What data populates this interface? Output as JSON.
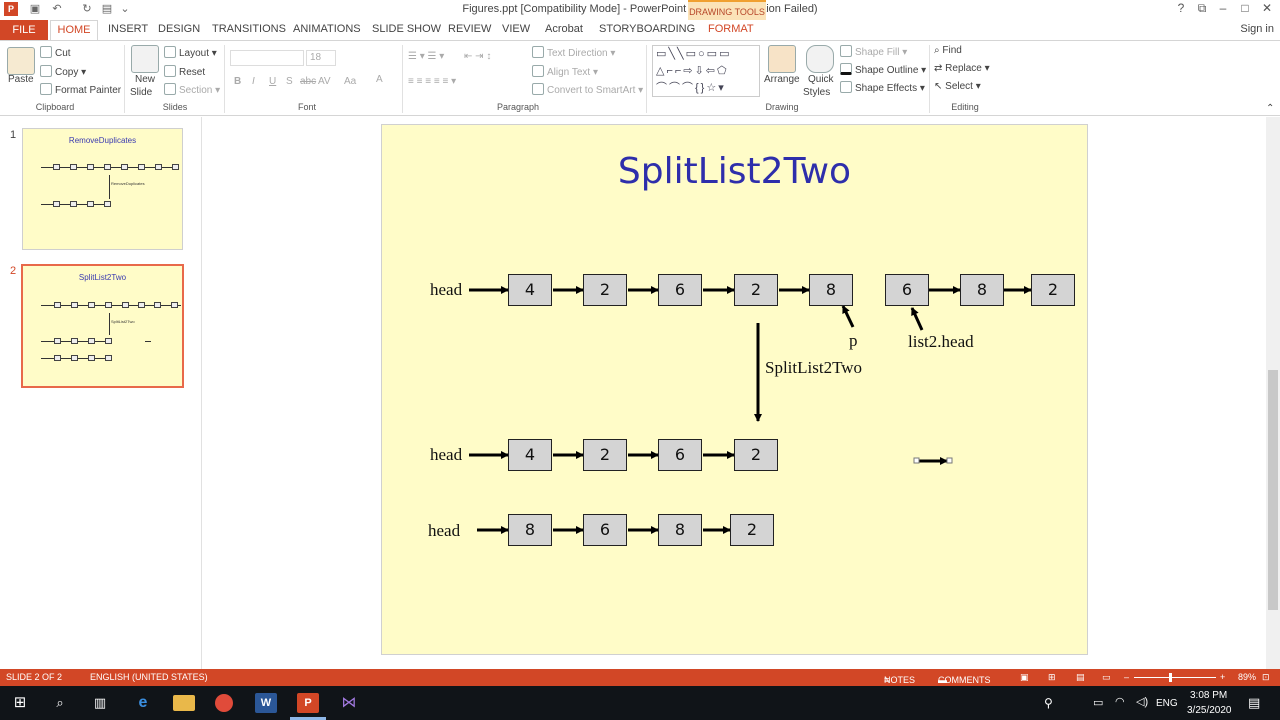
{
  "app": {
    "window_title": "Figures.ppt [Compatibility Mode] - PowerPoint (Product Activation Failed)",
    "drawing_tools_label": "DRAWING TOOLS",
    "sign_in": "Sign in",
    "window_controls": [
      "?",
      "⧉",
      "–",
      "□",
      "✕"
    ]
  },
  "tabs": [
    "FILE",
    "HOME",
    "INSERT",
    "DESIGN",
    "TRANSITIONS",
    "ANIMATIONS",
    "SLIDE SHOW",
    "REVIEW",
    "VIEW",
    "Acrobat",
    "STORYBOARDING",
    "FORMAT"
  ],
  "ribbon": {
    "clipboard": {
      "paste": "Paste",
      "cut": "Cut",
      "copy": "Copy",
      "format_painter": "Format Painter",
      "label": "Clipboard"
    },
    "slides": {
      "new_slide": "New",
      "new_slide2": "Slide",
      "layout": "Layout",
      "reset": "Reset",
      "section": "Section",
      "label": "Slides"
    },
    "font": {
      "size": "18",
      "label": "Font",
      "buttons": [
        "B",
        "I",
        "U",
        "S",
        "abc",
        "AV",
        "Aa",
        "A"
      ]
    },
    "paragraph": {
      "text_direction": "Text Direction",
      "align_text": "Align Text",
      "convert_smartart": "Convert to SmartArt",
      "label": "Paragraph"
    },
    "drawing": {
      "arrange": "Arrange",
      "quick_styles": "Quick",
      "quick_styles2": "Styles",
      "shape_fill": "Shape Fill",
      "shape_outline": "Shape Outline",
      "shape_effects": "Shape Effects",
      "label": "Drawing",
      "shapes_row1": "▭╲╲▭○▭▭",
      "shapes_row2": "△⌐⌐⇨⇩⇦⬠",
      "shapes_row3": "⌒⌒⌒{}☆▾"
    },
    "editing": {
      "find": "Find",
      "replace": "Replace",
      "select": "Select",
      "label": "Editing"
    }
  },
  "thumbnails": [
    {
      "num": "1",
      "title": "RemoveDuplicates",
      "middle_label": "RemoveDuplicates"
    },
    {
      "num": "2",
      "title": "SplitList2Two",
      "middle_label": "SplitList2Two"
    }
  ],
  "slide": {
    "title": "SplitList2Two",
    "row1": {
      "label": "head",
      "values": [
        "4",
        "2",
        "6",
        "2",
        "8"
      ]
    },
    "row1b": {
      "values": [
        "6",
        "8",
        "2"
      ]
    },
    "p_label": "p",
    "list2_label": "list2.head",
    "split_label": "SplitList2Two",
    "row2": {
      "label": "head",
      "values": [
        "4",
        "2",
        "6",
        "2"
      ]
    },
    "row3": {
      "label": "head",
      "values": [
        "8",
        "6",
        "8",
        "2"
      ]
    }
  },
  "statusbar": {
    "slide_info": "SLIDE 2 OF 2",
    "language": "ENGLISH (UNITED STATES)",
    "notes": "NOTES",
    "comments": "COMMENTS",
    "zoom": "89%"
  },
  "taskbar": {
    "time": "3:08 PM",
    "date": "3/25/2020",
    "lang": "ENG"
  }
}
